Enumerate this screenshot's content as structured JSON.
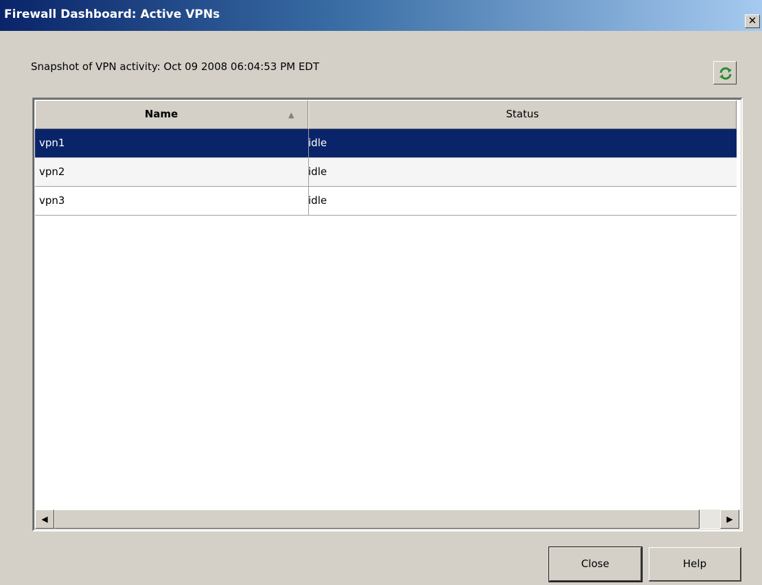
{
  "window": {
    "title": "Firewall Dashboard: Active VPNs",
    "close_glyph": "✕"
  },
  "snapshot": {
    "text": "Snapshot of VPN activity: Oct 09 2008 06:04:53 PM EDT"
  },
  "refresh": {
    "icon": "refresh-icon"
  },
  "table": {
    "columns": [
      {
        "label": "Name",
        "sort": "ascending"
      },
      {
        "label": "Status"
      }
    ],
    "rows": [
      {
        "name": "vpn1",
        "status": "idle",
        "selected": true
      },
      {
        "name": "vpn2",
        "status": "idle"
      },
      {
        "name": "vpn3",
        "status": "idle"
      }
    ]
  },
  "scrollbar": {
    "left_glyph": "◀",
    "right_glyph": "▶"
  },
  "buttons": {
    "close": "Close",
    "help": "Help"
  }
}
